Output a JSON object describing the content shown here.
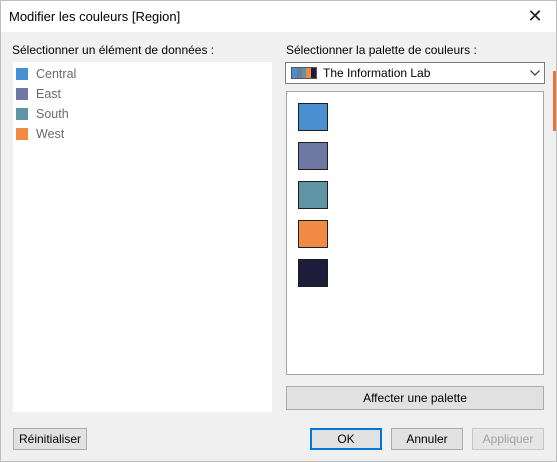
{
  "window": {
    "title": "Modifier les couleurs [Region]"
  },
  "left": {
    "label": "Sélectionner un élément de données :",
    "items": [
      {
        "label": "Central",
        "color": "#4a8fd0"
      },
      {
        "label": "East",
        "color": "#6f78a3"
      },
      {
        "label": "South",
        "color": "#5f94a4"
      },
      {
        "label": "West",
        "color": "#f08a44"
      }
    ]
  },
  "right": {
    "label": "Sélectionner la palette de couleurs :",
    "palette_name": "The Information Lab",
    "palette_icon_colors": [
      "#4a8fd0",
      "#6f78a3",
      "#5f94a4",
      "#f08a44",
      "#1c1d3b"
    ],
    "swatches": [
      "#4a8fd0",
      "#6f78a3",
      "#5f94a4",
      "#f08a44",
      "#1c1d3b"
    ],
    "assign_label": "Affecter une palette"
  },
  "buttons": {
    "reset": "Réinitialiser",
    "ok": "OK",
    "cancel": "Annuler",
    "apply": "Appliquer"
  }
}
